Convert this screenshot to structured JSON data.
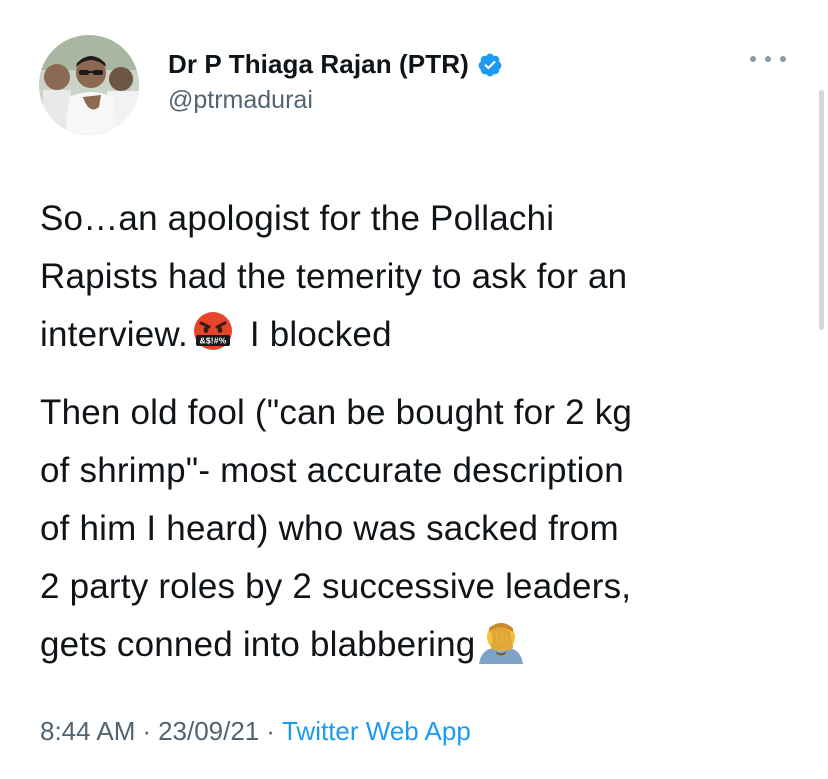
{
  "author": {
    "display_name": "Dr P Thiaga Rajan (PTR)",
    "handle": "@ptrmadurai",
    "verified_icon": "verified-badge-icon",
    "avatar_icon": "profile-photo"
  },
  "menu": {
    "more_icon": "more-options-icon"
  },
  "tweet": {
    "line1": "So…an apologist for the Pollachi",
    "line2": "Rapists had the temerity to ask for an",
    "line3a": "interview.",
    "line3b": "I blocked",
    "line4": "Then old fool (\"can be bought for 2 kg",
    "line5": "of shrimp\"- most accurate description",
    "line6": "of him I heard) who was sacked from",
    "line7": "2 party roles by 2 successive leaders,",
    "line8": "gets conned into blabbering",
    "emoji_angry_text": "&$!#%",
    "emoji_angry_icon": "cursing-face-emoji",
    "emoji_facepalm_icon": "facepalm-emoji"
  },
  "meta": {
    "time": "8:44 AM",
    "separator": "·",
    "date": "23/09/21",
    "source": "Twitter Web App"
  },
  "colors": {
    "text": "#0f1419",
    "secondary": "#536471",
    "link": "#1d9bf0",
    "verified": "#1d9bf0"
  }
}
